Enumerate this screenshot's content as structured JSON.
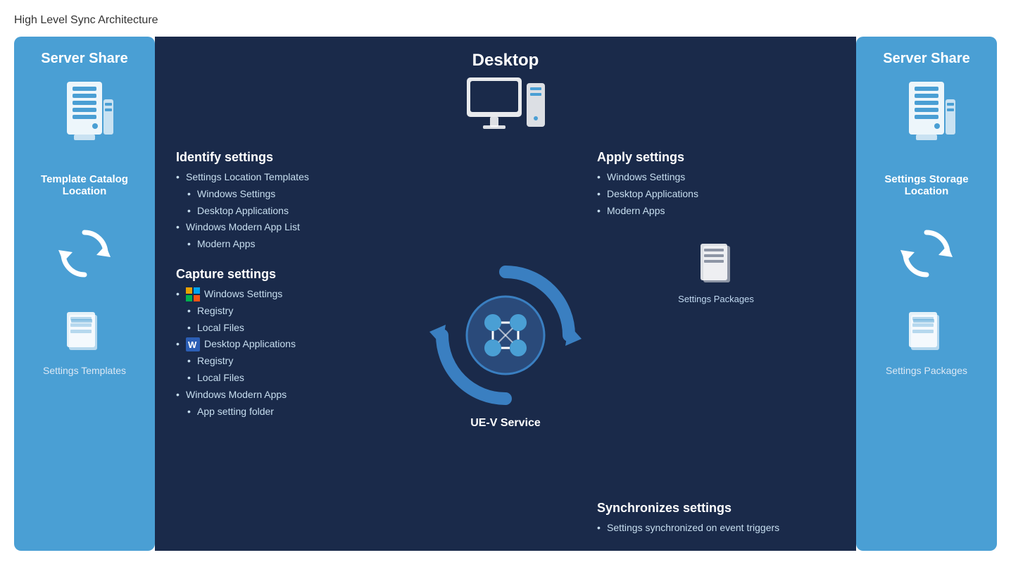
{
  "page": {
    "title": "High Level Sync Architecture"
  },
  "left_server": {
    "heading": "Server Share",
    "server_label": "Template Catalog Location",
    "sync_label": "",
    "file_label": "Settings Templates"
  },
  "right_server": {
    "heading": "Server Share",
    "server_label": "Settings Storage Location",
    "sync_label": "",
    "file_label": "Settings Packages"
  },
  "desktop": {
    "heading": "Desktop",
    "identify": {
      "title": "Identify settings",
      "items": [
        {
          "text": "Settings Location Templates",
          "level": 1
        },
        {
          "text": "Windows Settings",
          "level": 2
        },
        {
          "text": "Desktop Applications",
          "level": 2
        },
        {
          "text": "Windows Modern App List",
          "level": 1
        },
        {
          "text": "Modern Apps",
          "level": 2
        }
      ]
    },
    "apply": {
      "title": "Apply settings",
      "items": [
        {
          "text": "Windows Settings",
          "level": 1
        },
        {
          "text": "Desktop Applications",
          "level": 1
        },
        {
          "text": "Modern Apps",
          "level": 1
        }
      ]
    },
    "capture": {
      "title": "Capture settings",
      "items": [
        {
          "text": "Windows Settings",
          "level": 1
        },
        {
          "text": "Registry",
          "level": 2
        },
        {
          "text": "Local Files",
          "level": 2
        },
        {
          "text": "Desktop Applications",
          "level": 1
        },
        {
          "text": "Registry",
          "level": 2
        },
        {
          "text": "Local Files",
          "level": 2
        },
        {
          "text": "Windows Modern Apps",
          "level": 1
        },
        {
          "text": "App setting folder",
          "level": 2
        }
      ]
    },
    "sync": {
      "title": "Synchronizes settings",
      "items": [
        {
          "text": "Settings synchronized on event triggers",
          "level": 1
        }
      ]
    },
    "uev_label": "UE-V Service",
    "settings_packages": "Settings Packages"
  }
}
